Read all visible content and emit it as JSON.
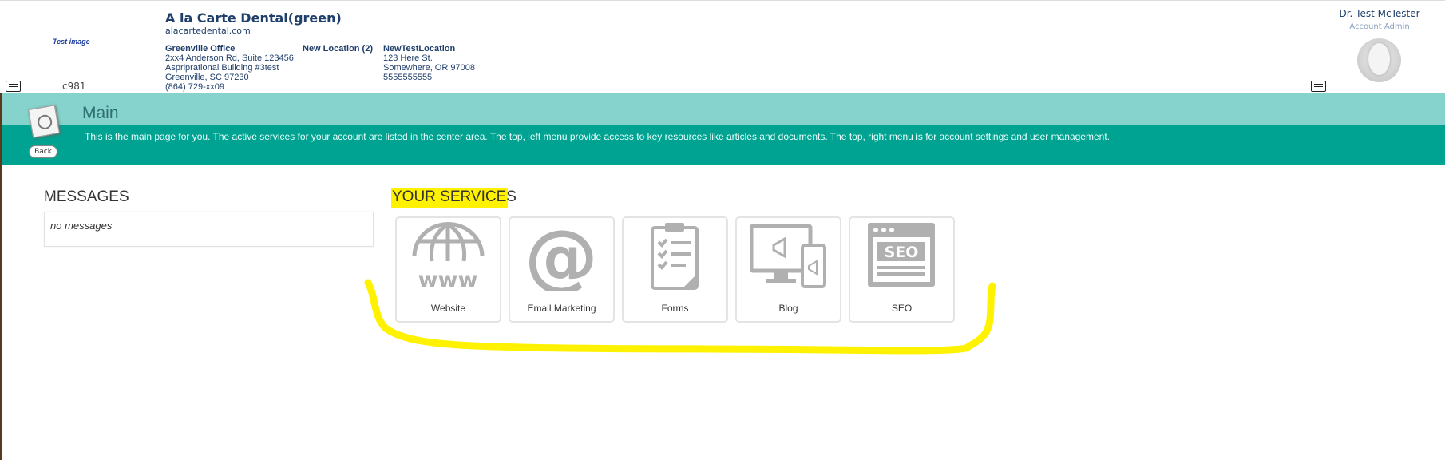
{
  "header": {
    "logo_text": "Test image",
    "account_code": "c981",
    "practice_name": "A la Carte Dental(green)",
    "practice_url": "alacartedental.com",
    "offices": [
      {
        "name": "Greenville Office",
        "line1": "2xx4 Anderson Rd, Suite 123456",
        "line2": "Aspriprational Building #3test",
        "line3": "Greenville, SC  97230",
        "line4": "(864) 729-xx09"
      },
      {
        "name": "New Location (2)"
      },
      {
        "name": "NewTestLocation",
        "line1": "123 Here St.",
        "line2": "Somewhere, OR  97008",
        "line3": "5555555555"
      }
    ],
    "user_name": "Dr. Test McTester",
    "user_role": "Account Admin"
  },
  "banner": {
    "title": "Main",
    "description": "This is the main page for you. The active services for your account are listed in the center area. The top, left menu provide access to key resources like articles and documents. The top, right menu is for account settings and user management.",
    "back_label": "Back"
  },
  "messages": {
    "heading": "MESSAGES",
    "empty_text": "no messages"
  },
  "services": {
    "heading": "YOUR SERVICES",
    "items": [
      {
        "label": "Website",
        "icon": "globe-www-icon"
      },
      {
        "label": "Email Marketing",
        "icon": "at-sign-icon"
      },
      {
        "label": "Forms",
        "icon": "clipboard-checklist-icon"
      },
      {
        "label": "Blog",
        "icon": "devices-megaphone-icon"
      },
      {
        "label": "SEO",
        "icon": "seo-browser-icon"
      }
    ]
  },
  "colors": {
    "banner_light": "#85d3cc",
    "banner_dark": "#00a391",
    "highlight": "#fff200",
    "icon_gray": "#b0b0b0",
    "brand_text": "#1f3e6a"
  }
}
